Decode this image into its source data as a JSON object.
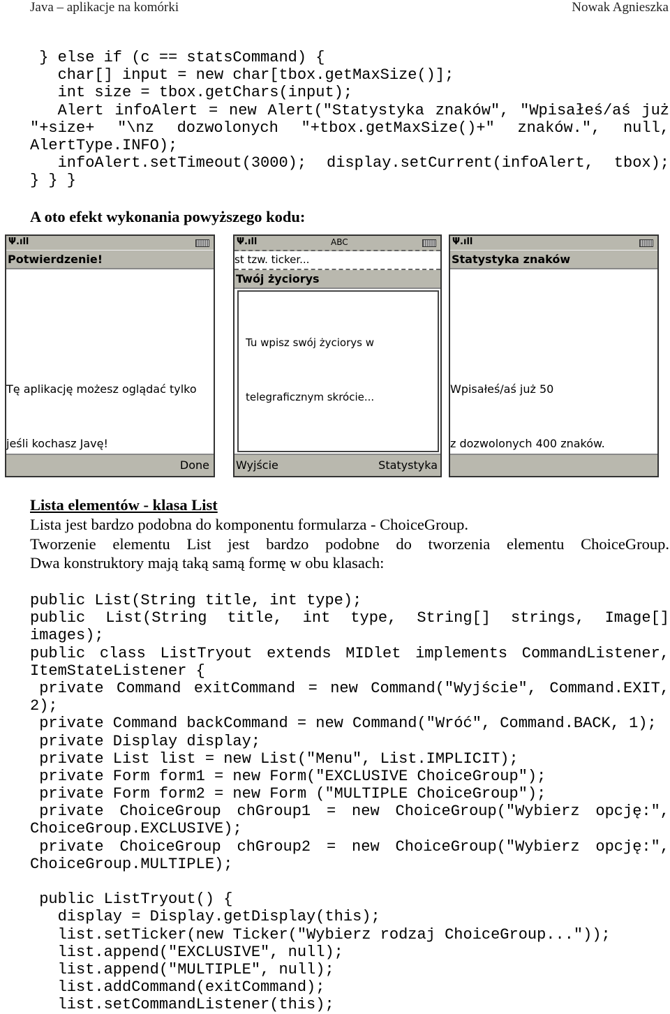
{
  "header": {
    "left": "Java – aplikacje na komórki",
    "right": "Nowak Agnieszka"
  },
  "code1": [
    {
      "t": "} else if (c == statsCommand) {",
      "i": 1
    },
    {
      "t": "char[] input = new char[tbox.getMaxSize()];",
      "i": 3
    },
    {
      "t": "int size = tbox.getChars(input);",
      "i": 3
    },
    {
      "t": "Alert infoAlert = new Alert(\"Statystyka znaków\", \"Wpisałeś/aś już",
      "i": 3,
      "j": true
    },
    {
      "t": "\"+size+ \"\\nz dozwolonych \"+tbox.getMaxSize()+\" znaków.\", null,",
      "i": 0,
      "j": true
    },
    {
      "t": "AlertType.INFO);",
      "i": 0
    },
    {
      "t": "infoAlert.setTimeout(3000); display.setCurrent(infoAlert, tbox);",
      "i": 3,
      "j": true
    },
    {
      "t": "} } }",
      "i": 0
    }
  ],
  "heading1": "A oto efekt wykonania powyższego kodu:",
  "screens": [
    {
      "title": "Potwierdzenie!",
      "body": [
        "Tę aplikację możesz oglądać tylko",
        "jeśli kochasz Javę!"
      ],
      "soft_right": "Done"
    },
    {
      "ticker": "st tzw. ticker...",
      "input_mode": "ABC",
      "title": "Twój życiorys",
      "body": [
        "Tu wpisz swój życiorys w",
        "telegraficznym skrócie..."
      ],
      "soft_left": "Wyjście",
      "soft_right": "Statystyka"
    },
    {
      "title": "Statystyka znaków",
      "body": [
        "Wpisałeś/aś już 50",
        "z dozwolonych 400 znaków."
      ]
    }
  ],
  "section": {
    "title": "Lista elementów - klasa List",
    "p1": "Lista jest bardzo podobna do komponentu formularza - ChoiceGroup.",
    "p2": "Tworzenie elementu List jest bardzo podobne do tworzenia elementu ChoiceGroup.",
    "p3": "Dwa konstruktory mają taką samą formę w obu klasach:"
  },
  "code2": [
    {
      "t": "public List(String title, int type);",
      "i": 0
    },
    {
      "t": "public List(String title, int type, String[] strings, Image[]",
      "i": 0,
      "j": true
    },
    {
      "t": "images);",
      "i": 0
    },
    {
      "t": "public class ListTryout extends MIDlet implements CommandListener,",
      "i": 0,
      "j": true
    },
    {
      "t": "ItemStateListener {",
      "i": 0
    },
    {
      "t": "private Command exitCommand = new Command(\"Wyjście\", Command.EXIT,",
      "i": 1,
      "j": true
    },
    {
      "t": "2);",
      "i": 0
    },
    {
      "t": "private Command backCommand = new Command(\"Wróć\", Command.BACK, 1);",
      "i": 1
    },
    {
      "t": "private Display display;",
      "i": 1
    },
    {
      "t": "private List list = new List(\"Menu\", List.IMPLICIT);",
      "i": 1
    },
    {
      "t": "private Form form1 = new Form(\"EXCLUSIVE ChoiceGroup\");",
      "i": 1
    },
    {
      "t": "private Form form2 = new Form (\"MULTIPLE ChoiceGroup\");",
      "i": 1
    },
    {
      "t": "private ChoiceGroup chGroup1 = new ChoiceGroup(\"Wybierz opcję:\",",
      "i": 1,
      "j": true
    },
    {
      "t": "ChoiceGroup.EXCLUSIVE);",
      "i": 0
    },
    {
      "t": "private ChoiceGroup chGroup2 = new ChoiceGroup(\"Wybierz opcję:\",",
      "i": 1,
      "j": true
    },
    {
      "t": "ChoiceGroup.MULTIPLE);",
      "i": 0
    },
    {
      "t": "",
      "i": 0
    },
    {
      "t": "public ListTryout() {",
      "i": 1
    },
    {
      "t": "display = Display.getDisplay(this);",
      "i": 3
    },
    {
      "t": "list.setTicker(new Ticker(\"Wybierz rodzaj ChoiceGroup...\"));",
      "i": 3
    },
    {
      "t": "list.append(\"EXCLUSIVE\", null);",
      "i": 3
    },
    {
      "t": "list.append(\"MULTIPLE\", null);",
      "i": 3
    },
    {
      "t": "list.addCommand(exitCommand);",
      "i": 3
    },
    {
      "t": "list.setCommandListener(this);",
      "i": 3
    }
  ]
}
